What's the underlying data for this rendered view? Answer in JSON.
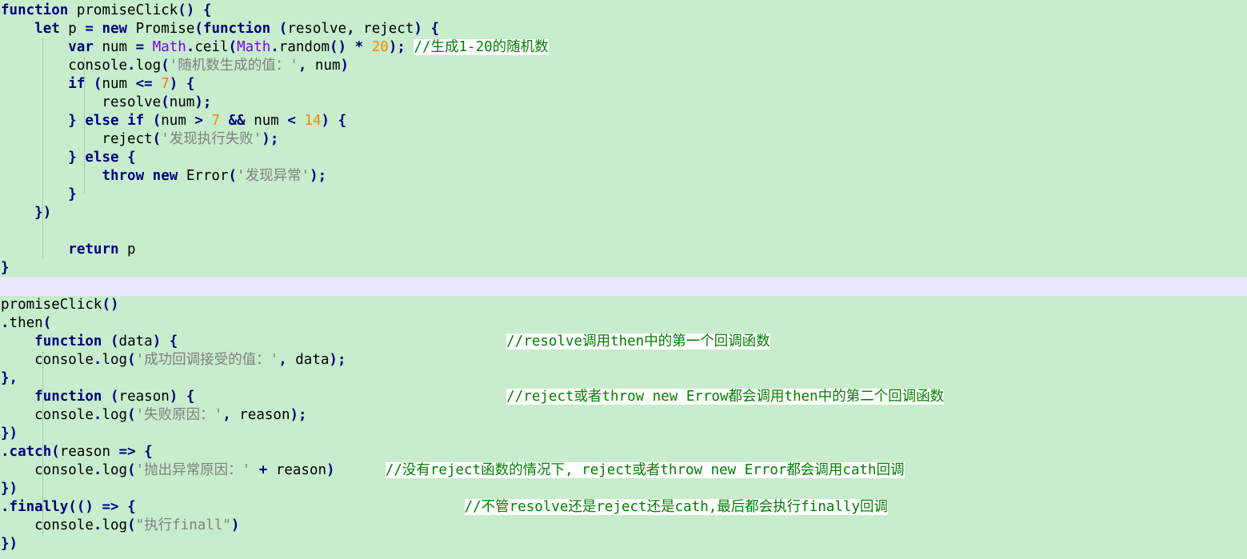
{
  "colors": {
    "background": "#c7edcc",
    "keyword": "#000080",
    "number": "#ff8000",
    "string": "#808080",
    "class": "#8000ff",
    "comment": "#008000",
    "separator_line": "#e8e8ff"
  },
  "editor": {
    "lines": [
      [
        [
          "kw",
          "function"
        ],
        [
          "txt",
          " promiseClick"
        ],
        [
          "op",
          "()"
        ],
        [
          "txt",
          " "
        ],
        [
          "op",
          "{"
        ]
      ],
      [
        [
          "txt",
          "    "
        ],
        [
          "kw",
          "let"
        ],
        [
          "txt",
          " p "
        ],
        [
          "op",
          "="
        ],
        [
          "txt",
          " "
        ],
        [
          "kw",
          "new"
        ],
        [
          "txt",
          " Promise"
        ],
        [
          "op",
          "("
        ],
        [
          "kw",
          "function"
        ],
        [
          "txt",
          " "
        ],
        [
          "op",
          "("
        ],
        [
          "txt",
          "resolve"
        ],
        [
          "op",
          ","
        ],
        [
          "txt",
          " reject"
        ],
        [
          "op",
          ")"
        ],
        [
          "txt",
          " "
        ],
        [
          "op",
          "{"
        ]
      ],
      [
        [
          "txt",
          "        "
        ],
        [
          "kw",
          "var"
        ],
        [
          "txt",
          " num "
        ],
        [
          "op",
          "="
        ],
        [
          "txt",
          " "
        ],
        [
          "cls",
          "Math"
        ],
        [
          "op",
          "."
        ],
        [
          "txt",
          "ceil"
        ],
        [
          "op",
          "("
        ],
        [
          "cls",
          "Math"
        ],
        [
          "op",
          "."
        ],
        [
          "txt",
          "random"
        ],
        [
          "op",
          "()"
        ],
        [
          "txt",
          " "
        ],
        [
          "op",
          "*"
        ],
        [
          "txt",
          " "
        ],
        [
          "num",
          "20"
        ],
        [
          "op",
          ");"
        ],
        [
          "txt",
          " "
        ],
        [
          "cm",
          "//生成1-20的随机数"
        ]
      ],
      [
        [
          "txt",
          "        console"
        ],
        [
          "op",
          "."
        ],
        [
          "txt",
          "log"
        ],
        [
          "op",
          "("
        ],
        [
          "str",
          "'随机数生成的值：'"
        ],
        [
          "op",
          ","
        ],
        [
          "txt",
          " num"
        ],
        [
          "op",
          ")"
        ]
      ],
      [
        [
          "txt",
          "        "
        ],
        [
          "kw",
          "if"
        ],
        [
          "txt",
          " "
        ],
        [
          "op",
          "("
        ],
        [
          "txt",
          "num "
        ],
        [
          "op",
          "<="
        ],
        [
          "txt",
          " "
        ],
        [
          "num",
          "7"
        ],
        [
          "op",
          ")"
        ],
        [
          "txt",
          " "
        ],
        [
          "op",
          "{"
        ]
      ],
      [
        [
          "txt",
          "            resolve"
        ],
        [
          "op",
          "("
        ],
        [
          "txt",
          "num"
        ],
        [
          "op",
          ");"
        ]
      ],
      [
        [
          "txt",
          "        "
        ],
        [
          "op",
          "}"
        ],
        [
          "txt",
          " "
        ],
        [
          "kw",
          "else"
        ],
        [
          "txt",
          " "
        ],
        [
          "kw",
          "if"
        ],
        [
          "txt",
          " "
        ],
        [
          "op",
          "("
        ],
        [
          "txt",
          "num "
        ],
        [
          "op",
          ">"
        ],
        [
          "txt",
          " "
        ],
        [
          "num",
          "7"
        ],
        [
          "txt",
          " "
        ],
        [
          "op",
          "&&"
        ],
        [
          "txt",
          " num "
        ],
        [
          "op",
          "<"
        ],
        [
          "txt",
          " "
        ],
        [
          "num",
          "14"
        ],
        [
          "op",
          ")"
        ],
        [
          "txt",
          " "
        ],
        [
          "op",
          "{"
        ]
      ],
      [
        [
          "txt",
          "            reject"
        ],
        [
          "op",
          "("
        ],
        [
          "str",
          "'发现执行失败'"
        ],
        [
          "op",
          ");"
        ]
      ],
      [
        [
          "txt",
          "        "
        ],
        [
          "op",
          "}"
        ],
        [
          "txt",
          " "
        ],
        [
          "kw",
          "else"
        ],
        [
          "txt",
          " "
        ],
        [
          "op",
          "{"
        ]
      ],
      [
        [
          "txt",
          "            "
        ],
        [
          "kw",
          "throw"
        ],
        [
          "txt",
          " "
        ],
        [
          "kw",
          "new"
        ],
        [
          "txt",
          " Error"
        ],
        [
          "op",
          "("
        ],
        [
          "str",
          "'发现异常'"
        ],
        [
          "op",
          ");"
        ]
      ],
      [
        [
          "txt",
          "        "
        ],
        [
          "op",
          "}"
        ]
      ],
      [
        [
          "txt",
          "    "
        ],
        [
          "op",
          "})"
        ]
      ],
      [
        [
          "txt",
          ""
        ]
      ],
      [
        [
          "txt",
          "        "
        ],
        [
          "kw",
          "return"
        ],
        [
          "txt",
          " p"
        ]
      ],
      [
        [
          "op",
          "}"
        ]
      ],
      [
        [
          "txt",
          ""
        ]
      ],
      [
        [
          "txt",
          "promiseClick"
        ],
        [
          "op",
          "()"
        ]
      ],
      [
        [
          "op",
          "."
        ],
        [
          "txt",
          "then"
        ],
        [
          "op",
          "("
        ]
      ],
      [
        [
          "txt",
          "    "
        ],
        [
          "kw",
          "function"
        ],
        [
          "txt",
          " "
        ],
        [
          "op",
          "("
        ],
        [
          "txt",
          "data"
        ],
        [
          "op",
          ")"
        ],
        [
          "txt",
          " "
        ],
        [
          "op",
          "{"
        ],
        [
          "txt",
          "                                       "
        ],
        [
          "cm",
          "//resolve调用then中的第一个回调函数"
        ]
      ],
      [
        [
          "txt",
          "    console"
        ],
        [
          "op",
          "."
        ],
        [
          "txt",
          "log"
        ],
        [
          "op",
          "("
        ],
        [
          "str",
          "'成功回调接受的值：'"
        ],
        [
          "op",
          ","
        ],
        [
          "txt",
          " data"
        ],
        [
          "op",
          ");"
        ]
      ],
      [
        [
          "op",
          "},"
        ]
      ],
      [
        [
          "txt",
          "    "
        ],
        [
          "kw",
          "function"
        ],
        [
          "txt",
          " "
        ],
        [
          "op",
          "("
        ],
        [
          "txt",
          "reason"
        ],
        [
          "op",
          ")"
        ],
        [
          "txt",
          " "
        ],
        [
          "op",
          "{"
        ],
        [
          "txt",
          "                                     "
        ],
        [
          "cm",
          "//reject或者throw new Errow都会调用then中的第二个回调函数"
        ]
      ],
      [
        [
          "txt",
          "    console"
        ],
        [
          "op",
          "."
        ],
        [
          "txt",
          "log"
        ],
        [
          "op",
          "("
        ],
        [
          "str",
          "'失败原因：'"
        ],
        [
          "op",
          ","
        ],
        [
          "txt",
          " reason"
        ],
        [
          "op",
          ");"
        ]
      ],
      [
        [
          "op",
          "})"
        ]
      ],
      [
        [
          "op",
          "."
        ],
        [
          "kw",
          "catch"
        ],
        [
          "op",
          "("
        ],
        [
          "txt",
          "reason "
        ],
        [
          "op",
          "=>"
        ],
        [
          "txt",
          " "
        ],
        [
          "op",
          "{"
        ]
      ],
      [
        [
          "txt",
          "    console"
        ],
        [
          "op",
          "."
        ],
        [
          "txt",
          "log"
        ],
        [
          "op",
          "("
        ],
        [
          "str",
          "'抛出异常原因：'"
        ],
        [
          "txt",
          " "
        ],
        [
          "op",
          "+"
        ],
        [
          "txt",
          " reason"
        ],
        [
          "op",
          ")"
        ],
        [
          "txt",
          "      "
        ],
        [
          "cm",
          "//没有reject函数的情况下, reject或者throw new Error都会调用cath回调"
        ]
      ],
      [
        [
          "op",
          "})"
        ]
      ],
      [
        [
          "op",
          "."
        ],
        [
          "kw",
          "finally"
        ],
        [
          "op",
          "(()"
        ],
        [
          "txt",
          " "
        ],
        [
          "op",
          "=>"
        ],
        [
          "txt",
          " "
        ],
        [
          "op",
          "{"
        ],
        [
          "txt",
          "                                       "
        ],
        [
          "cm",
          "//不管resolve还是reject还是cath,最后都会执行finally回调"
        ]
      ],
      [
        [
          "txt",
          "    console"
        ],
        [
          "op",
          "."
        ],
        [
          "txt",
          "log"
        ],
        [
          "op",
          "("
        ],
        [
          "str",
          "\"执行finall\""
        ],
        [
          "op",
          ")"
        ]
      ],
      [
        [
          "op",
          "})"
        ]
      ]
    ]
  }
}
